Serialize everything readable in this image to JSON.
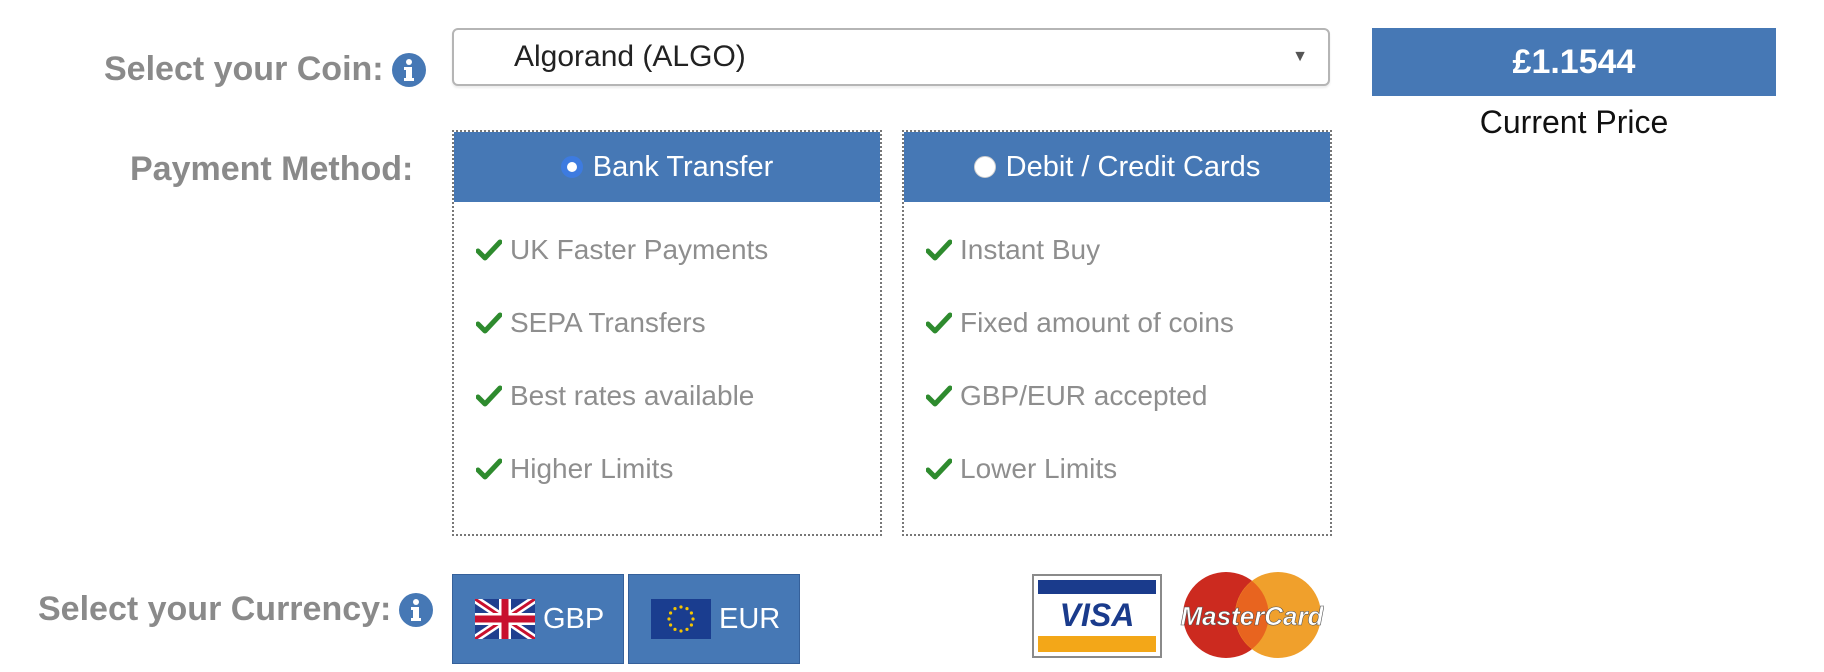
{
  "labels": {
    "coin": "Select your Coin:",
    "payment": "Payment Method:",
    "currency": "Select your Currency:"
  },
  "coin_select": {
    "value": "Algorand (ALGO)",
    "arrow": "▼"
  },
  "price": {
    "value": "£1.1544",
    "label": "Current Price"
  },
  "payment_methods": [
    {
      "label": "Bank Transfer",
      "selected": true,
      "features": [
        "UK Faster Payments",
        "SEPA Transfers",
        "Best rates available",
        "Higher Limits"
      ]
    },
    {
      "label": "Debit / Credit Cards",
      "selected": false,
      "features": [
        "Instant Buy",
        "Fixed amount of coins",
        "GBP/EUR accepted",
        "Lower Limits"
      ]
    }
  ],
  "currencies": [
    {
      "code": "GBP",
      "flag": "uk-flag-icon"
    },
    {
      "code": "EUR",
      "flag": "eu-flag-icon"
    }
  ],
  "card_logos": {
    "visa": "VISA",
    "mastercard": "MasterCard"
  },
  "colors": {
    "accent": "#4678b5",
    "label_gray": "#8a8a8a",
    "check_green": "#2e8b2e",
    "radio_blue": "#3d7be0"
  }
}
